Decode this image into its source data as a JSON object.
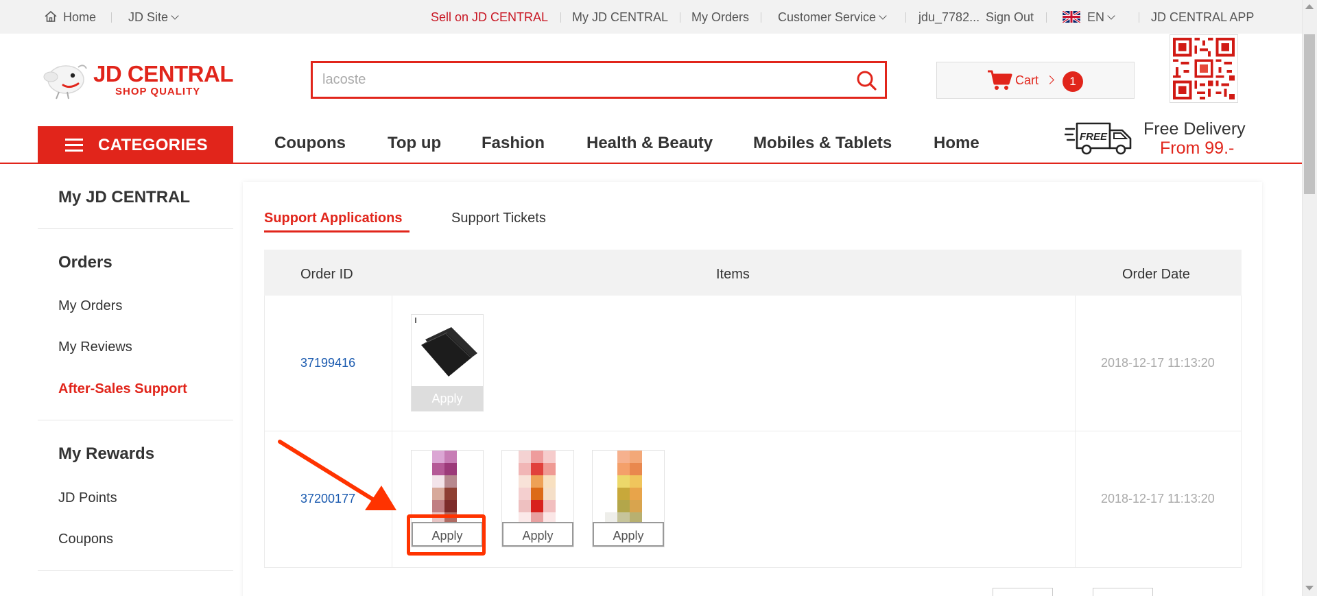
{
  "topbar": {
    "home": "Home",
    "site": "JD Site",
    "sell": "Sell on JD CENTRAL",
    "my_jd": "My JD CENTRAL",
    "my_orders": "My Orders",
    "customer_service": "Customer Service",
    "user": "jdu_7782...",
    "sign_out": "Sign Out",
    "language": "EN",
    "app": "JD CENTRAL APP"
  },
  "logo": {
    "title": "JD CENTRAL",
    "tagline": "SHOP QUALITY"
  },
  "search": {
    "placeholder": "lacoste"
  },
  "cart": {
    "label": "Cart",
    "count": "1"
  },
  "nav": {
    "categories": "CATEGORIES",
    "links": [
      "Coupons",
      "Top up",
      "Fashion",
      "Health & Beauty",
      "Mobiles & Tablets",
      "Home"
    ]
  },
  "promo": {
    "badge": "FREE",
    "line1": "Free Delivery",
    "line2": "From 99.-"
  },
  "sidebar": {
    "title": "My JD CENTRAL",
    "sections": [
      {
        "heading": "Orders",
        "links": [
          "My Orders",
          "My Reviews",
          "After-Sales Support"
        ]
      },
      {
        "heading": "My Rewards",
        "links": [
          "JD Points",
          "Coupons"
        ]
      }
    ]
  },
  "tabs": [
    "Support Applications",
    "Support Tickets"
  ],
  "table": {
    "headers": [
      "Order ID",
      "Items",
      "Order Date"
    ],
    "rows": [
      {
        "order_id": "37199416",
        "date": "2018-12-17 11:13:20",
        "apply": [
          "Apply"
        ]
      },
      {
        "order_id": "37200177",
        "date": "2018-12-17 11:13:20",
        "apply": [
          "Apply",
          "Apply",
          "Apply"
        ]
      }
    ]
  },
  "colors": {
    "brand_red": "#e1251b",
    "link_blue": "#1a5aaf",
    "annotation_red": "#ff3300"
  }
}
